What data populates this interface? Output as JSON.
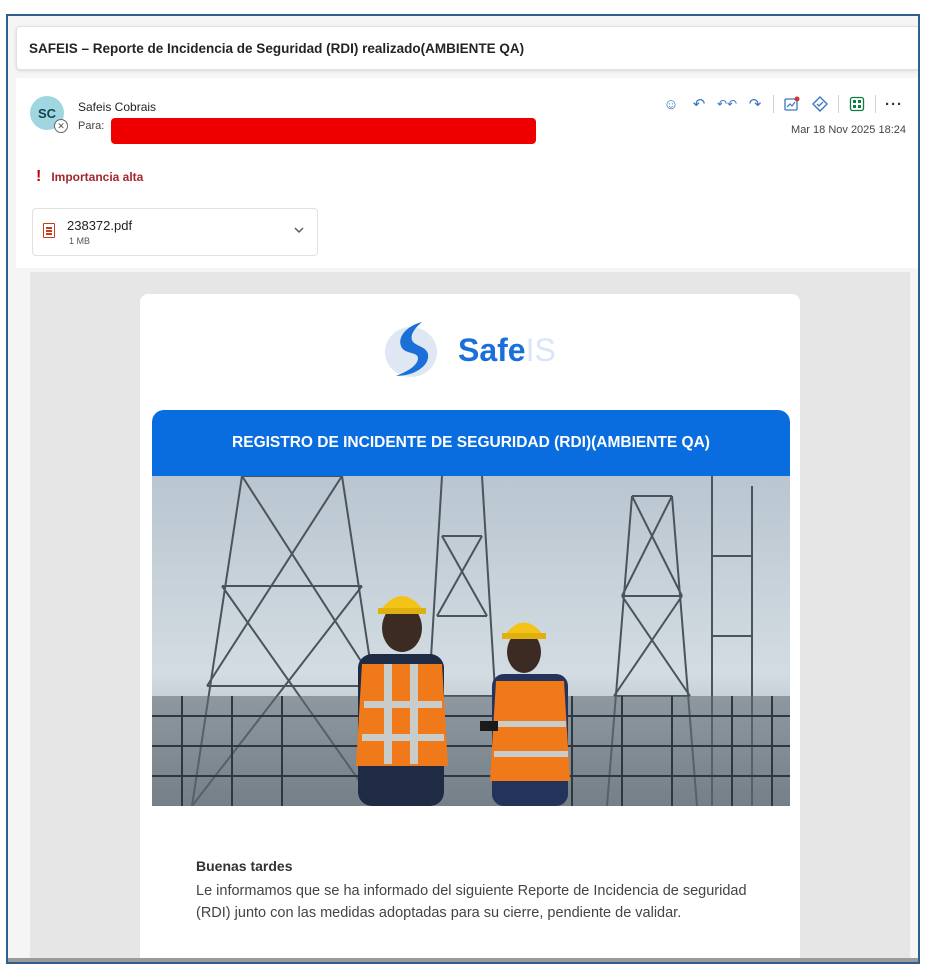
{
  "subject": "SAFEIS – Reporte de Incidencia de Seguridad (RDI) realizado(AMBIENTE QA)",
  "sender": {
    "initials": "SC",
    "name": "Safeis Cobrais",
    "to_label": "Para:"
  },
  "date": "Mar 18 Nov 2025 18:24",
  "importance": {
    "icon": "!",
    "label": "Importancia alta"
  },
  "attachment": {
    "name": "238372.pdf",
    "size": "1 MB"
  },
  "toolbar": {
    "icons": [
      "emoji-icon",
      "reply-icon",
      "reply-all-icon",
      "forward-icon",
      "report-icon",
      "tag-icon",
      "apps-icon",
      "more-icon"
    ],
    "emoji": "☺",
    "reply": "↶",
    "reply_all": "↶↶",
    "forward": "↷",
    "more": "···"
  },
  "email": {
    "logo_main": "Safe",
    "logo_suffix": "IS",
    "banner": "REGISTRO DE INCIDENTE DE SEGURIDAD (RDI)(AMBIENTE QA)",
    "greeting": "Buenas tardes",
    "paragraph": "Le informamos que se ha informado del siguiente Reporte de Incidencia de seguridad (RDI) junto con las medidas adoptadas para su cierre, pendiente de validar."
  },
  "colors": {
    "accent": "#0a6ddf",
    "importance": "#a4262c",
    "redaction": "#ee0000",
    "avatar": "#9fd6e0"
  }
}
